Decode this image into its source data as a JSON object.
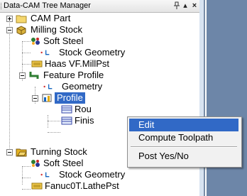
{
  "panel": {
    "title": "Data-CAM Tree Manager",
    "pin_glyph": "⁴",
    "dropdown_glyph": "▴",
    "close_glyph": "×"
  },
  "tree": {
    "cam_part": "CAM Part",
    "milling_stock": "Milling Stock",
    "soft_steel_1": "Soft Steel",
    "stock_geometry_1": "Stock Geometry",
    "haas_post": "Haas VF.MillPst",
    "feature_profile": "Feature Profile",
    "geometry": "Geometry",
    "profile": "Profile",
    "roughing": "Rou",
    "finishing": "Finis",
    "turning_stock": "Turning Stock",
    "soft_steel_2": "Soft Steel",
    "stock_geometry_2": "Stock Geometry",
    "fanuc_post": "Fanuc0T.LathePst"
  },
  "context_menu": {
    "edit": "Edit",
    "compute_toolpath": "Compute Toolpath",
    "post_yes_no": "Post Yes/No"
  },
  "colors": {
    "selection": "#3169c6",
    "panel_edge": "#6d86a8"
  },
  "icons": {
    "cam_part": "folder-icon",
    "milling_stock": "stock-box-icon",
    "material": "material-icon",
    "stock_geometry": "stock-geometry-icon",
    "post": "post-processor-icon",
    "feature": "feature-profile-icon",
    "operation": "operation-icon",
    "toolpath": "toolpath-icon"
  }
}
